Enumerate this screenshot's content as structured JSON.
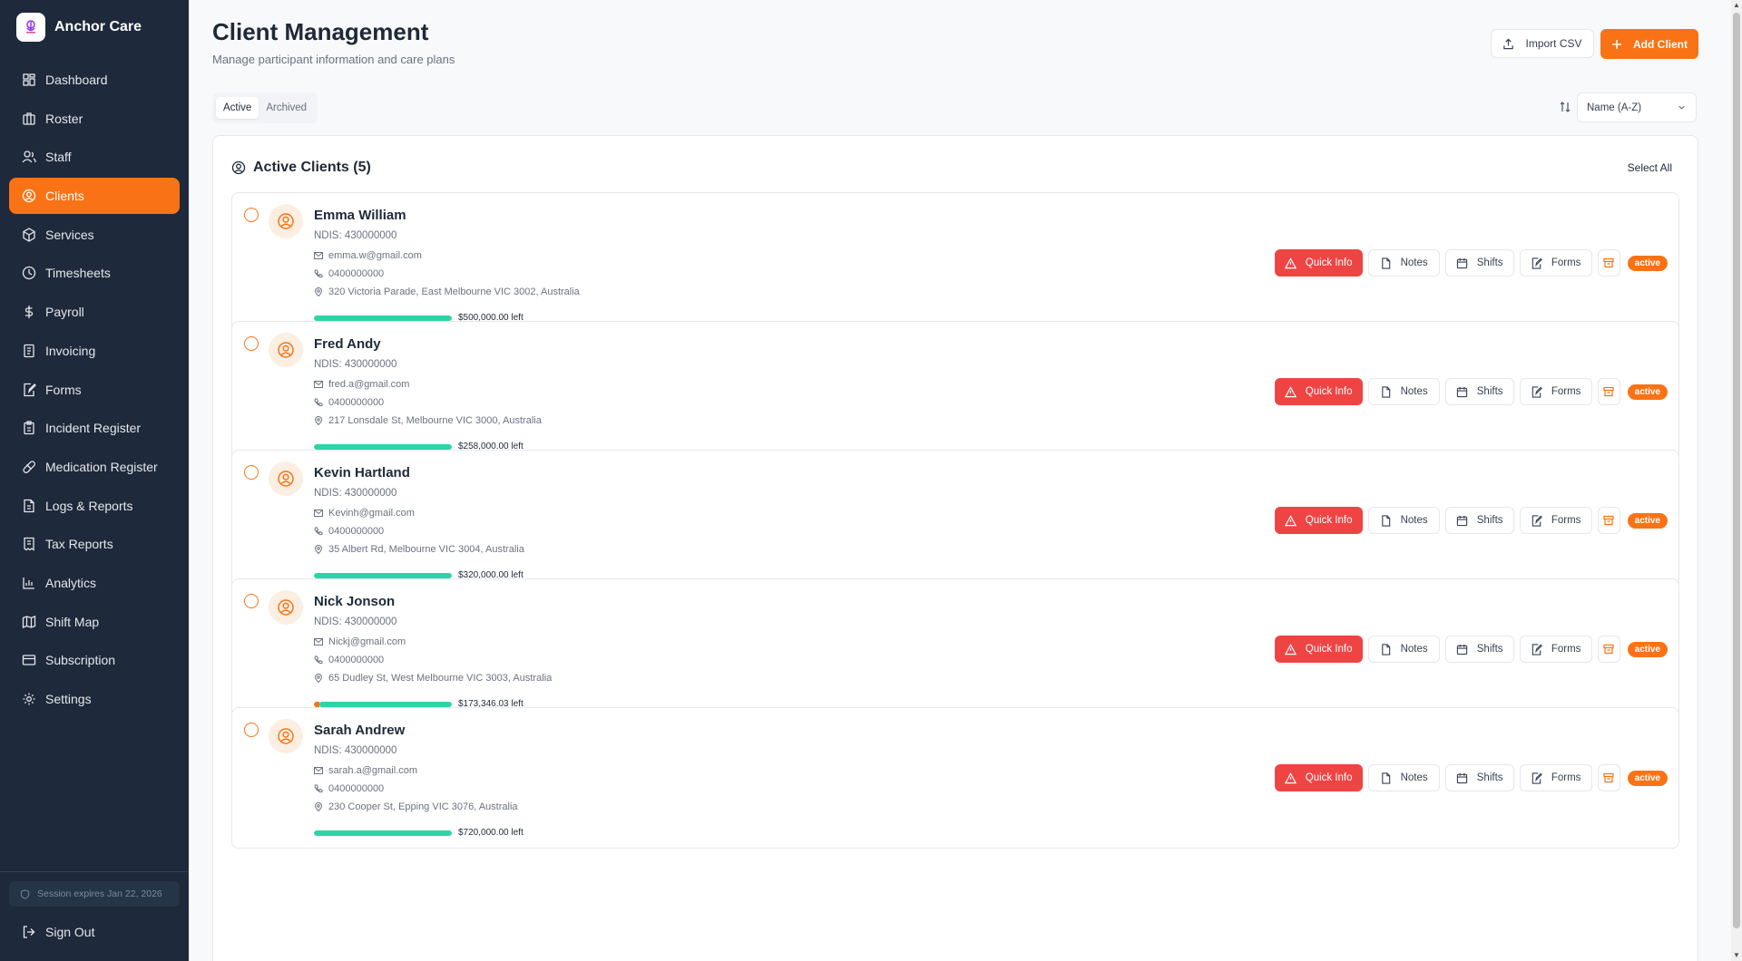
{
  "app": {
    "name": "Anchor Care"
  },
  "sidebar": {
    "items": [
      {
        "label": "Dashboard",
        "icon": "dashboard-icon"
      },
      {
        "label": "Roster",
        "icon": "roster-icon"
      },
      {
        "label": "Staff",
        "icon": "staff-icon"
      },
      {
        "label": "Clients",
        "icon": "clients-icon",
        "active": true
      },
      {
        "label": "Services",
        "icon": "services-icon"
      },
      {
        "label": "Timesheets",
        "icon": "clock-icon"
      },
      {
        "label": "Payroll",
        "icon": "dollar-icon"
      },
      {
        "label": "Invoicing",
        "icon": "invoice-icon"
      },
      {
        "label": "Forms",
        "icon": "forms-icon"
      },
      {
        "label": "Incident Register",
        "icon": "clipboard-icon"
      },
      {
        "label": "Medication Register",
        "icon": "pill-icon"
      },
      {
        "label": "Logs & Reports",
        "icon": "report-icon"
      },
      {
        "label": "Tax Reports",
        "icon": "receipt-icon"
      },
      {
        "label": "Analytics",
        "icon": "chart-icon"
      },
      {
        "label": "Shift Map",
        "icon": "map-icon"
      },
      {
        "label": "Subscription",
        "icon": "card-icon"
      },
      {
        "label": "Settings",
        "icon": "gear-icon"
      }
    ],
    "session": "Session expires Jan 22, 2026",
    "signout": "Sign Out"
  },
  "header": {
    "title": "Client Management",
    "subtitle": "Manage participant information and care plans",
    "import_label": "Import CSV",
    "add_label": "Add Client"
  },
  "tabs": {
    "active": "Active",
    "archived": "Archived"
  },
  "sort": {
    "value": "Name (A-Z)"
  },
  "panel": {
    "title": "Active Clients (5)",
    "select_all": "Select All"
  },
  "actions": {
    "quick_info": "Quick Info",
    "notes": "Notes",
    "shifts": "Shifts",
    "forms": "Forms"
  },
  "clients": [
    {
      "name": "Emma William",
      "ndis": "NDIS: 430000000",
      "email": "emma.w@gmail.com",
      "phone": "0400000000",
      "address": "320 Victoria Parade, East Melbourne VIC 3002, Australia",
      "budget_left": "$500,000.00 left",
      "budget_fraction": 1.0,
      "status": "active"
    },
    {
      "name": "Fred Andy",
      "ndis": "NDIS: 430000000",
      "email": "fred.a@gmail.com",
      "phone": "0400000000",
      "address": "217 Lonsdale St, Melbourne VIC 3000, Australia",
      "budget_left": "$258,000.00 left",
      "budget_fraction": 1.0,
      "status": "active"
    },
    {
      "name": "Kevin Hartland",
      "ndis": "NDIS: 430000000",
      "email": "Kevinh@gmail.com",
      "phone": "0400000000",
      "address": "35 Albert Rd, Melbourne VIC 3004, Australia",
      "budget_left": "$320,000.00 left",
      "budget_fraction": 1.0,
      "status": "active"
    },
    {
      "name": "Nick Jonson",
      "ndis": "NDIS: 430000000",
      "email": "Nickj@gmail.com",
      "phone": "0400000000",
      "address": "65 Dudley St, West Melbourne VIC 3003, Australia",
      "budget_left": "$173,346.03 left",
      "budget_fraction": 0.96,
      "status": "active"
    },
    {
      "name": "Sarah Andrew",
      "ndis": "NDIS: 430000000",
      "email": "sarah.a@gmail.com",
      "phone": "0400000000",
      "address": "230 Cooper St, Epping VIC 3076, Australia",
      "budget_left": "$720,000.00 left",
      "budget_fraction": 1.0,
      "status": "active"
    }
  ],
  "colors": {
    "accent": "#f97316",
    "danger": "#ef4444",
    "budget": "#2dd4a8",
    "sidebar": "#1e293b"
  }
}
